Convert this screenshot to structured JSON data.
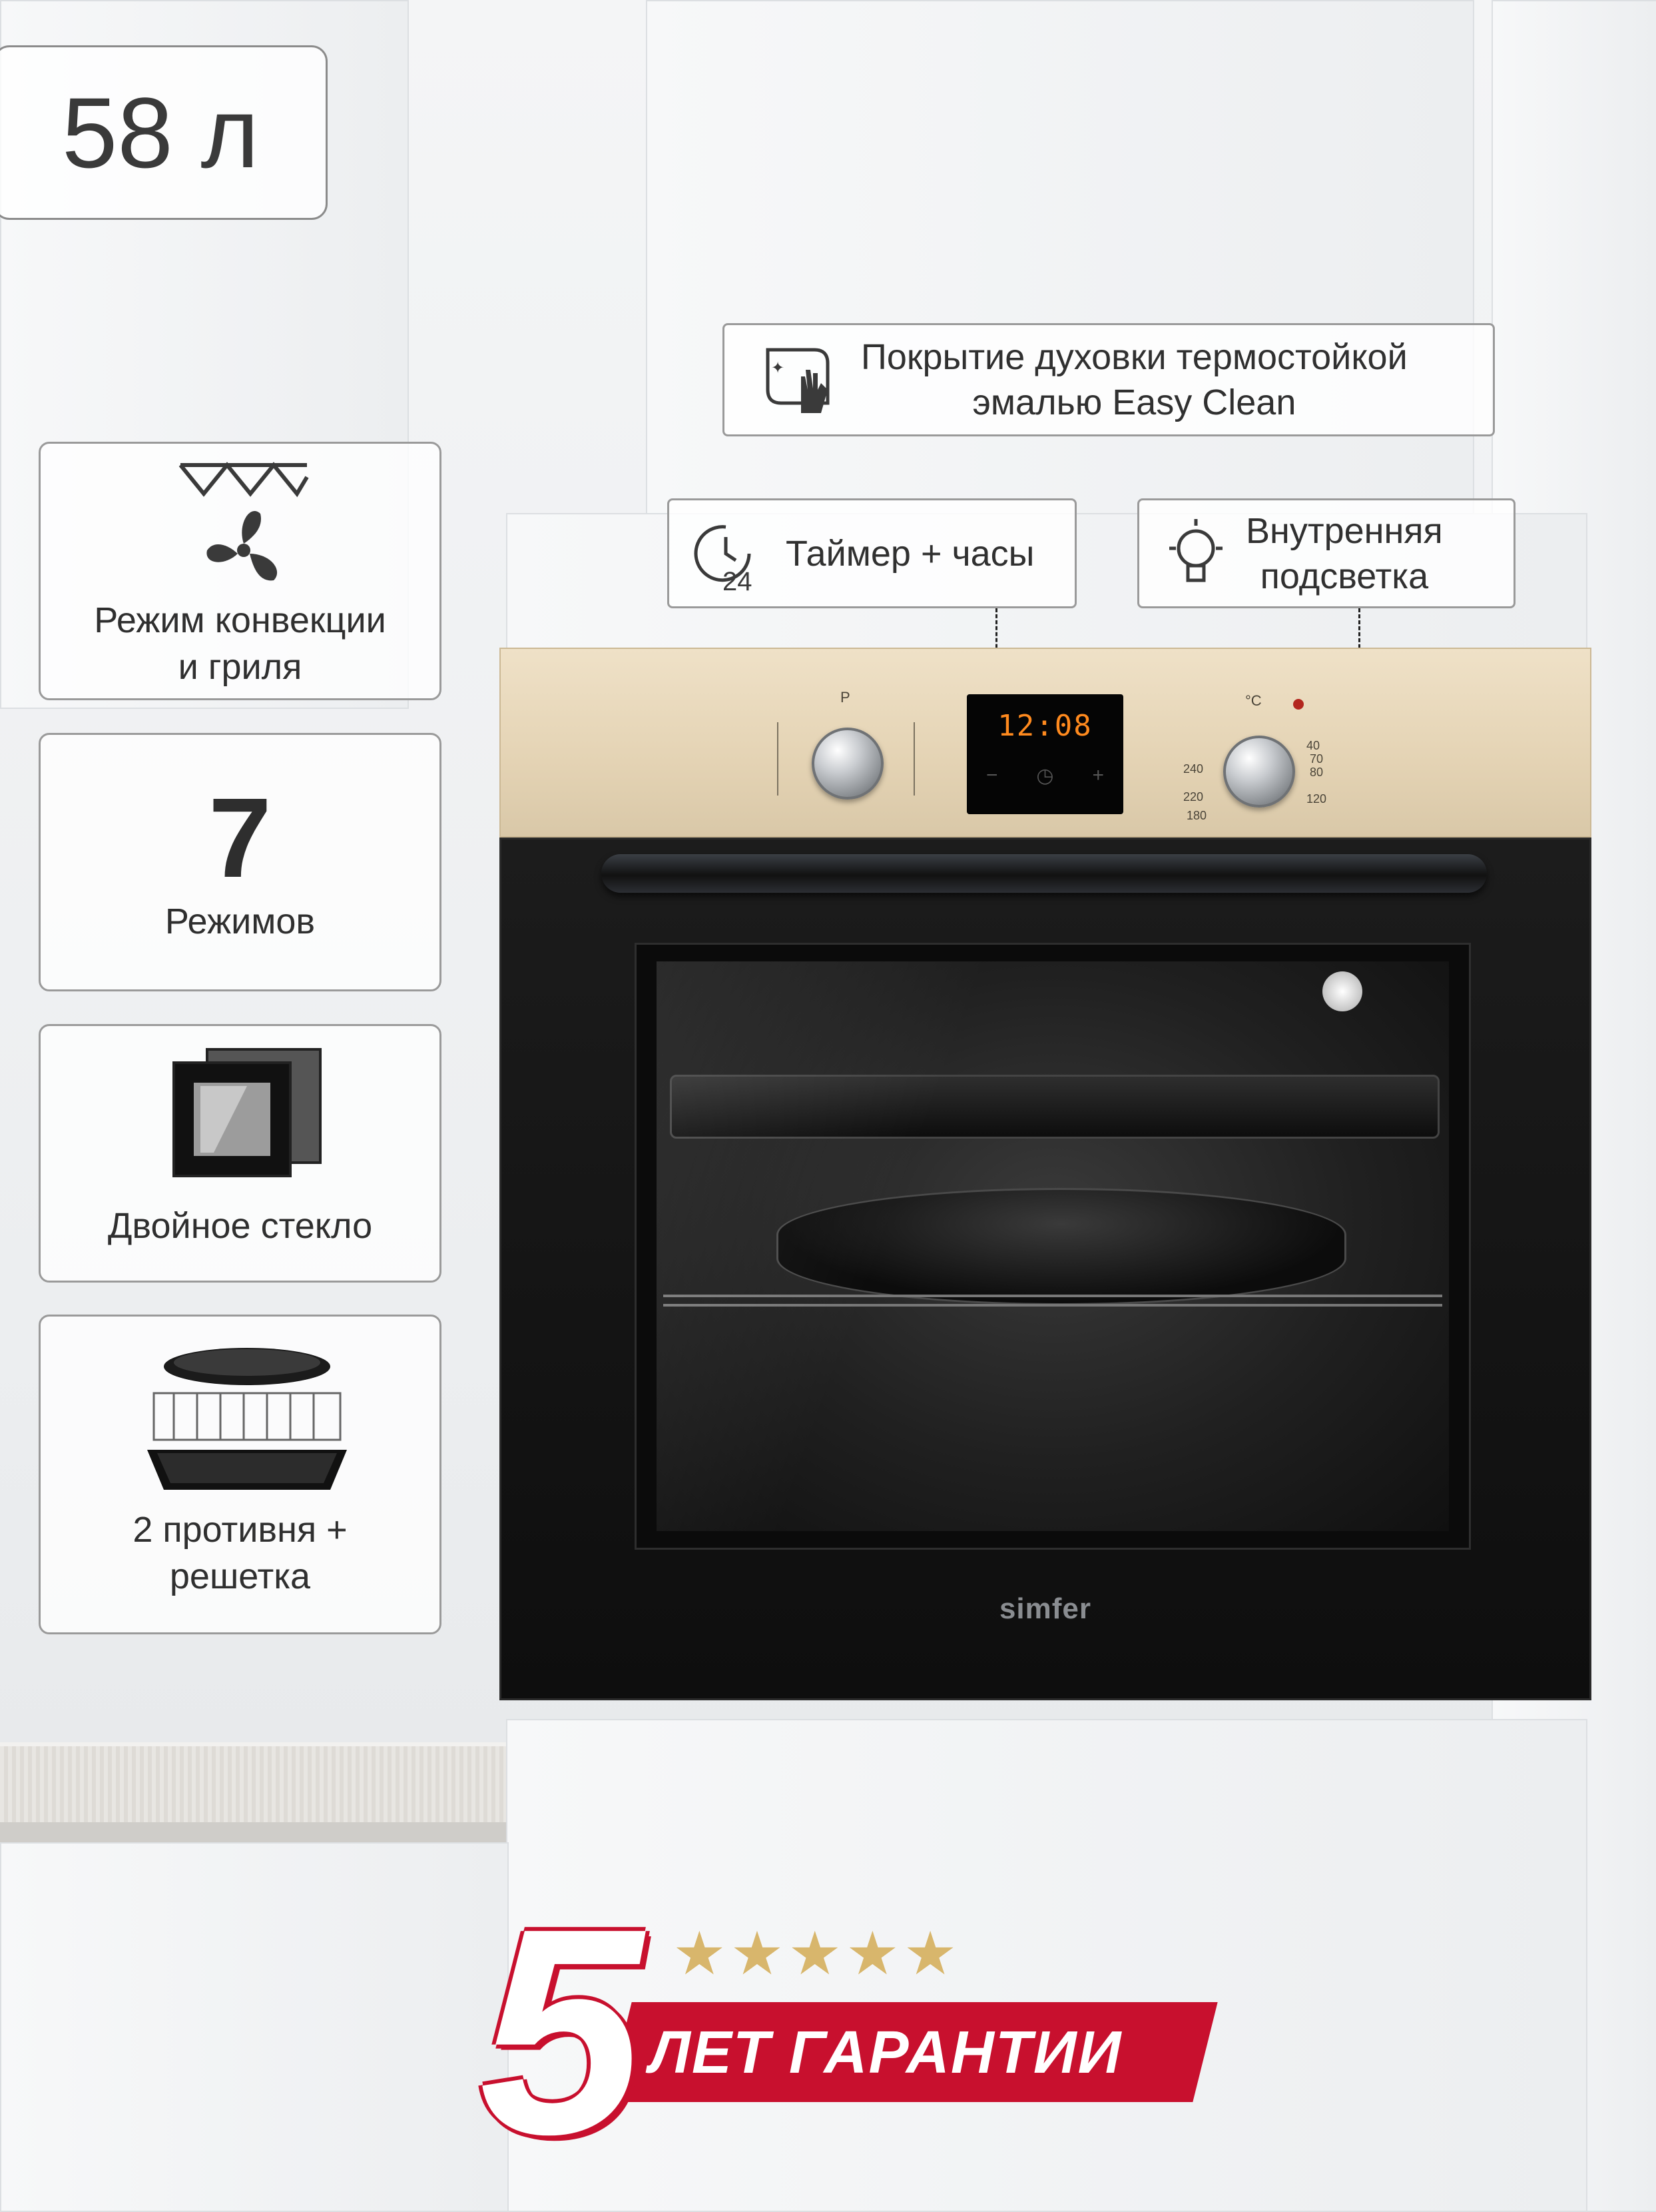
{
  "volume": "58 л",
  "features": [
    {
      "icon": "convection-grill-icon",
      "label_lines": [
        "Режим конвекции",
        "и гриля"
      ]
    },
    {
      "big": "7",
      "label_lines": [
        "Режимов"
      ]
    },
    {
      "icon": "double-glass-icon",
      "label_lines": [
        "Двойное стекло"
      ]
    },
    {
      "icon": "trays-grill-icon",
      "label_lines": [
        "2 противня +",
        "решетка"
      ]
    }
  ],
  "callouts": {
    "easy_clean": {
      "icon": "easy-clean-icon",
      "lines": [
        "Покрытие духовки термостойкой",
        "эмалью Easy Clean"
      ]
    },
    "timer": {
      "icon": "timer-clock-icon",
      "lines": [
        "Таймер + часы"
      ]
    },
    "light": {
      "icon": "bulb-icon",
      "lines": [
        "Внутренняя",
        "подсветка"
      ]
    }
  },
  "oven": {
    "brand": "simfer",
    "display_time": "12:08",
    "left_knob_label": "P",
    "right_knob_label": "°C",
    "temp_marks": [
      "40",
      "70",
      "80",
      "120",
      "180",
      "220",
      "240"
    ],
    "display_controls": [
      "−",
      "◷",
      "+"
    ],
    "accent_panel": "#e8d8bb",
    "indicator": "#b3261e"
  },
  "guarantee": {
    "number": "5",
    "text": "ЛЕТ ГАРАНТИИ",
    "stars": "★★★★★",
    "band_color": "#c8102e",
    "star_color": "#d8b66c"
  }
}
